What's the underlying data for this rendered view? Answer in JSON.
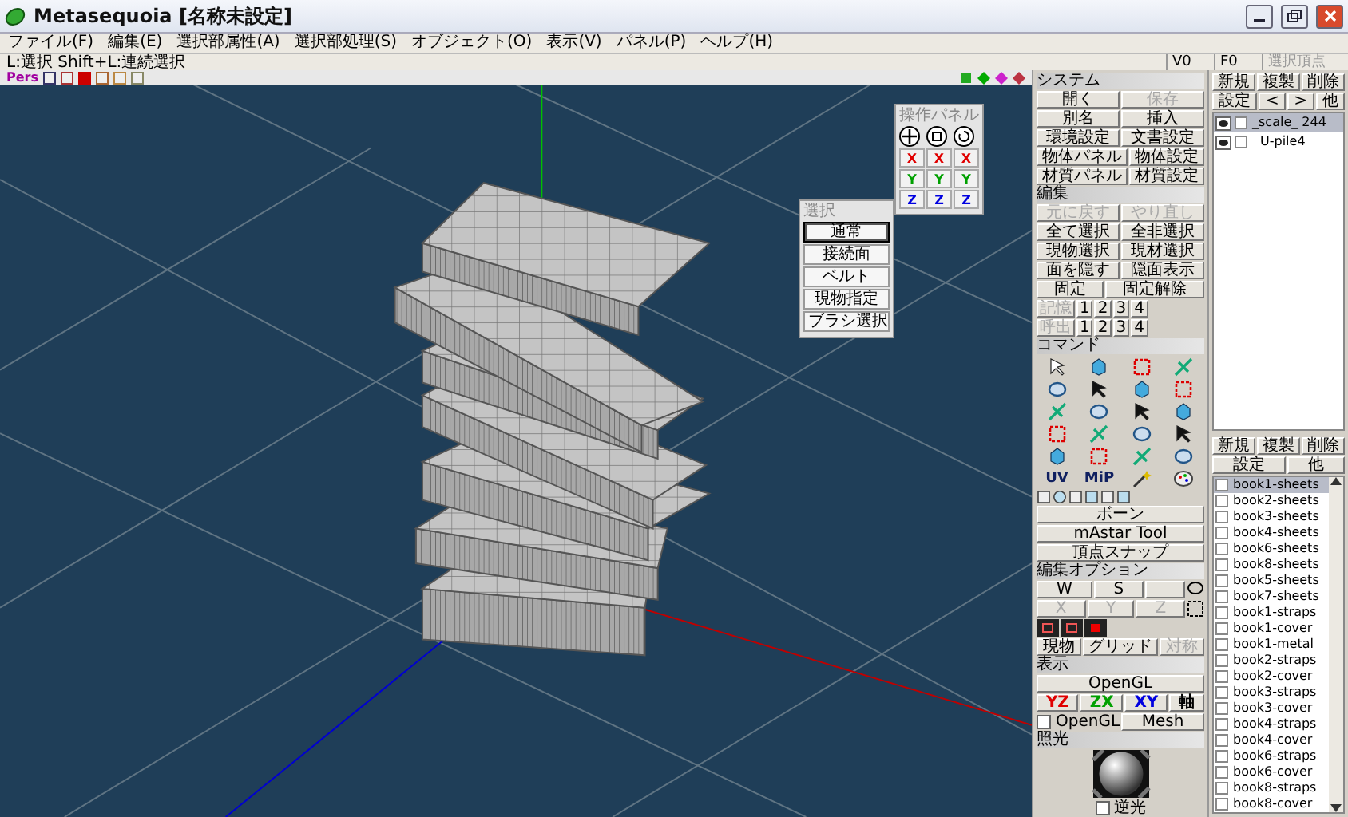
{
  "window": {
    "title": "Metasequoia [名称未設定]"
  },
  "menu": [
    "ファイル(F)",
    "編集(E)",
    "選択部属性(A)",
    "選択部処理(S)",
    "オブジェクト(O)",
    "表示(V)",
    "パネル(P)",
    "ヘルプ(H)"
  ],
  "status": {
    "hint": "L:選択 Shift+L:連続選択",
    "vertices": "V0",
    "faces": "F0",
    "selected_vertices": "選択頂点"
  },
  "viewport": {
    "mode": "Pers"
  },
  "operation_panel": {
    "title": "操作パネル",
    "rows": [
      {
        "color": "#e00000",
        "buttons": [
          "X",
          "X",
          "X"
        ]
      },
      {
        "color": "#00a000",
        "buttons": [
          "Y",
          "Y",
          "Y"
        ]
      },
      {
        "color": "#0000e0",
        "buttons": [
          "Z",
          "Z",
          "Z"
        ]
      }
    ]
  },
  "select_panel": {
    "title": "選択",
    "modes": [
      {
        "label": "通常",
        "selected": true
      },
      {
        "label": "接続面",
        "selected": false
      },
      {
        "label": "ベルト",
        "selected": false
      },
      {
        "label": "現物指定",
        "selected": false
      },
      {
        "label": "ブラシ選択",
        "selected": false
      }
    ]
  },
  "system": {
    "title": "システム",
    "rows": [
      [
        {
          "label": "開く",
          "disabled": false
        },
        {
          "label": "保存",
          "disabled": true
        }
      ],
      [
        {
          "label": "別名",
          "disabled": false
        },
        {
          "label": "挿入",
          "disabled": false
        }
      ],
      [
        {
          "label": "環境設定",
          "disabled": false
        },
        {
          "label": "文書設定",
          "disabled": false
        }
      ],
      [
        {
          "label": "物体パネル",
          "disabled": false
        },
        {
          "label": "物体設定",
          "disabled": false
        }
      ],
      [
        {
          "label": "材質パネル",
          "disabled": false
        },
        {
          "label": "材質設定",
          "disabled": false
        }
      ]
    ]
  },
  "edit": {
    "title": "編集",
    "rows": [
      [
        {
          "label": "元に戻す",
          "disabled": true
        },
        {
          "label": "やり直し",
          "disabled": true
        }
      ],
      [
        {
          "label": "全て選択",
          "disabled": false
        },
        {
          "label": "全非選択",
          "disabled": false
        }
      ],
      [
        {
          "label": "現物選択",
          "disabled": false
        },
        {
          "label": "現材選択",
          "disabled": false
        }
      ],
      [
        {
          "label": "面を隠す",
          "disabled": false
        },
        {
          "label": "隠面表示",
          "disabled": false
        }
      ],
      [
        {
          "label": "固定",
          "disabled": false
        },
        {
          "label": "固定解除",
          "disabled": false
        }
      ],
      [
        {
          "label": "記憶",
          "disabled": true
        },
        {
          "label": "1",
          "disabled": false
        },
        {
          "label": "2",
          "disabled": false
        },
        {
          "label": "3",
          "disabled": false
        },
        {
          "label": "4",
          "disabled": false
        }
      ],
      [
        {
          "label": "呼出",
          "disabled": true
        },
        {
          "label": "1",
          "disabled": false
        },
        {
          "label": "2",
          "disabled": false
        },
        {
          "label": "3",
          "disabled": false
        },
        {
          "label": "4",
          "disabled": false
        }
      ]
    ]
  },
  "commands": {
    "title": "コマンド",
    "icon_labels": [
      "UV",
      "MiP"
    ],
    "buttons": [
      "ボーン",
      "mAstar Tool",
      "頂点スナップ"
    ]
  },
  "edit_options": {
    "title": "編集オプション",
    "rows": [
      [
        {
          "label": "W",
          "disabled": false
        },
        {
          "label": "S",
          "disabled": false
        }
      ],
      [
        {
          "label": "X",
          "disabled": true
        },
        {
          "label": "Y",
          "disabled": true
        },
        {
          "label": "Z",
          "disabled": true
        }
      ]
    ],
    "buttons": [
      {
        "label": "現物",
        "disabled": false
      },
      {
        "label": "グリッド",
        "disabled": false
      },
      {
        "label": "対称",
        "disabled": true
      }
    ]
  },
  "display": {
    "title": "表示",
    "main_button": "OpenGL",
    "axes": [
      {
        "label": "YZ",
        "color": "#e00000"
      },
      {
        "label": "ZX",
        "color": "#00a000"
      },
      {
        "label": "XY",
        "color": "#0000e0"
      },
      {
        "label": "軸",
        "color": "#000000"
      }
    ],
    "opengl_check": {
      "label": "OpenGL",
      "checked": false
    },
    "mesh_button": "Mesh"
  },
  "lighting": {
    "title": "照光",
    "backlight": {
      "label": "逆光",
      "checked": false
    }
  },
  "objects": {
    "buttons": [
      [
        "新規",
        "複製",
        "削除"
      ],
      [
        "設定",
        "<",
        ">",
        "他"
      ]
    ],
    "items": [
      {
        "name": "_scale_ 244",
        "selected": true,
        "visible": true
      },
      {
        "name": "U-pile4",
        "selected": false,
        "visible": true
      }
    ]
  },
  "materials": {
    "buttons": [
      [
        "新規",
        "複製",
        "削除"
      ],
      [
        "設定",
        "他"
      ]
    ],
    "items": [
      {
        "name": "book1-sheets",
        "selected": true
      },
      {
        "name": "book2-sheets",
        "selected": false
      },
      {
        "name": "book3-sheets",
        "selected": false
      },
      {
        "name": "book4-sheets",
        "selected": false
      },
      {
        "name": "book6-sheets",
        "selected": false
      },
      {
        "name": "book8-sheets",
        "selected": false
      },
      {
        "name": "book5-sheets",
        "selected": false
      },
      {
        "name": "book7-sheets",
        "selected": false
      },
      {
        "name": "book1-straps",
        "selected": false
      },
      {
        "name": "book1-cover",
        "selected": false
      },
      {
        "name": "book1-metal",
        "selected": false
      },
      {
        "name": "book2-straps",
        "selected": false
      },
      {
        "name": "book2-cover",
        "selected": false
      },
      {
        "name": "book3-straps",
        "selected": false
      },
      {
        "name": "book3-cover",
        "selected": false
      },
      {
        "name": "book4-straps",
        "selected": false
      },
      {
        "name": "book4-cover",
        "selected": false
      },
      {
        "name": "book6-straps",
        "selected": false
      },
      {
        "name": "book6-cover",
        "selected": false
      },
      {
        "name": "book8-straps",
        "selected": false
      },
      {
        "name": "book8-cover",
        "selected": false
      }
    ]
  }
}
